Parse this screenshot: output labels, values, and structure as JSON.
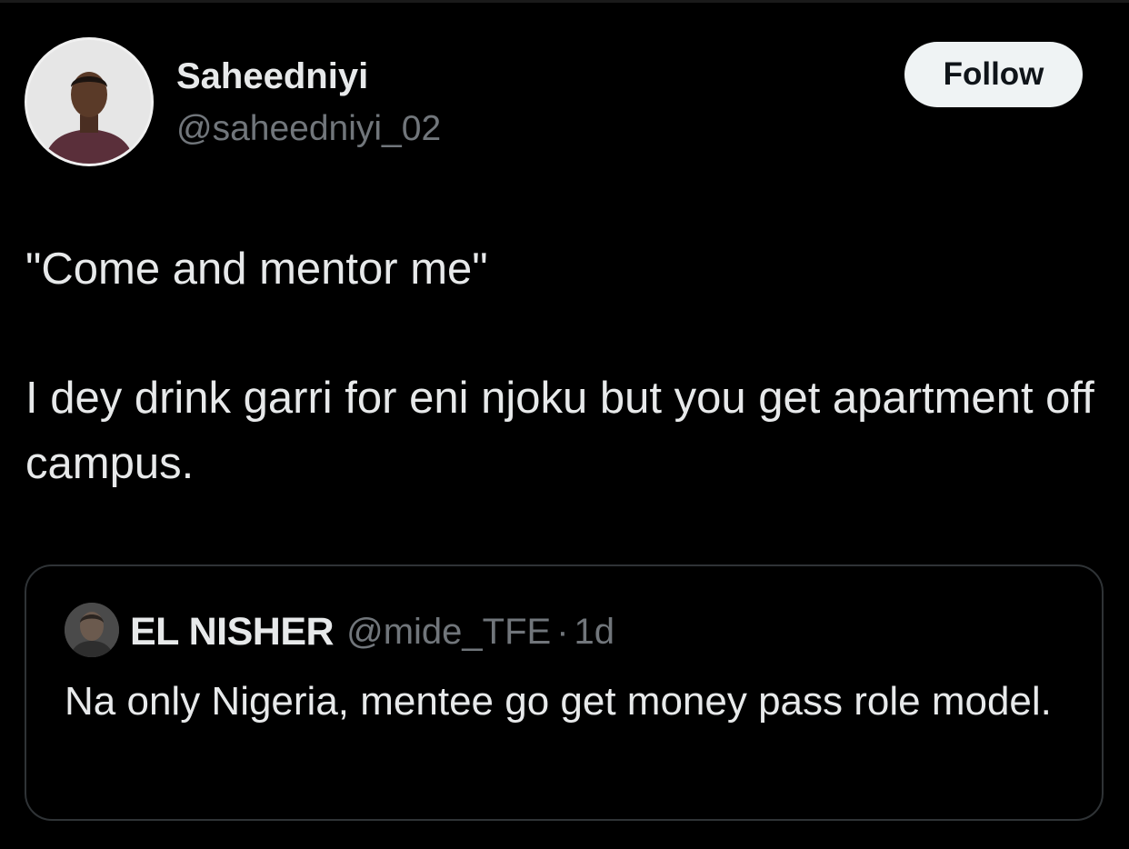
{
  "author": {
    "display_name": "Saheedniyi",
    "handle": "@saheedniyi_02",
    "avatar_icon": "profile-photo"
  },
  "follow_button": {
    "label": "Follow"
  },
  "tweet": {
    "paragraphs": [
      "\"Come and mentor me\"",
      "I dey drink garri for eni njoku but you get apartment off campus."
    ]
  },
  "quote": {
    "display_name": "EL NISHER",
    "handle": "@mide_TFE",
    "separator": "·",
    "time": "1d",
    "text": "Na only Nigeria, mentee go get money pass role model.",
    "avatar_icon": "profile-photo"
  },
  "colors": {
    "background": "#000000",
    "primary_text": "#e7e9ea",
    "secondary_text": "#71767b",
    "border": "#2f3336",
    "follow_bg": "#eff3f4",
    "follow_text": "#0f1419"
  }
}
